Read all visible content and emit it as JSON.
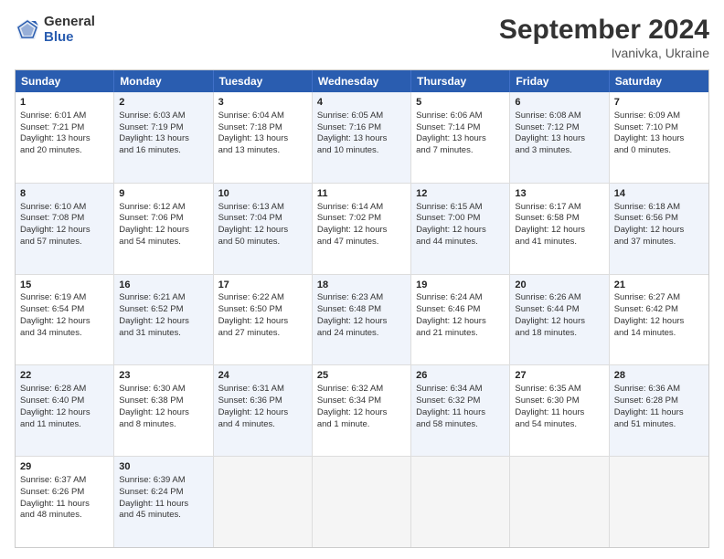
{
  "header": {
    "logo_general": "General",
    "logo_blue": "Blue",
    "month_title": "September 2024",
    "subtitle": "Ivanivka, Ukraine"
  },
  "calendar": {
    "days_of_week": [
      "Sunday",
      "Monday",
      "Tuesday",
      "Wednesday",
      "Thursday",
      "Friday",
      "Saturday"
    ],
    "rows": [
      [
        {
          "day": "1",
          "info": "Sunrise: 6:01 AM\nSunset: 7:21 PM\nDaylight: 13 hours\nand 20 minutes.",
          "empty": false,
          "alt": false
        },
        {
          "day": "2",
          "info": "Sunrise: 6:03 AM\nSunset: 7:19 PM\nDaylight: 13 hours\nand 16 minutes.",
          "empty": false,
          "alt": true
        },
        {
          "day": "3",
          "info": "Sunrise: 6:04 AM\nSunset: 7:18 PM\nDaylight: 13 hours\nand 13 minutes.",
          "empty": false,
          "alt": false
        },
        {
          "day": "4",
          "info": "Sunrise: 6:05 AM\nSunset: 7:16 PM\nDaylight: 13 hours\nand 10 minutes.",
          "empty": false,
          "alt": true
        },
        {
          "day": "5",
          "info": "Sunrise: 6:06 AM\nSunset: 7:14 PM\nDaylight: 13 hours\nand 7 minutes.",
          "empty": false,
          "alt": false
        },
        {
          "day": "6",
          "info": "Sunrise: 6:08 AM\nSunset: 7:12 PM\nDaylight: 13 hours\nand 3 minutes.",
          "empty": false,
          "alt": true
        },
        {
          "day": "7",
          "info": "Sunrise: 6:09 AM\nSunset: 7:10 PM\nDaylight: 13 hours\nand 0 minutes.",
          "empty": false,
          "alt": false
        }
      ],
      [
        {
          "day": "8",
          "info": "Sunrise: 6:10 AM\nSunset: 7:08 PM\nDaylight: 12 hours\nand 57 minutes.",
          "empty": false,
          "alt": true
        },
        {
          "day": "9",
          "info": "Sunrise: 6:12 AM\nSunset: 7:06 PM\nDaylight: 12 hours\nand 54 minutes.",
          "empty": false,
          "alt": false
        },
        {
          "day": "10",
          "info": "Sunrise: 6:13 AM\nSunset: 7:04 PM\nDaylight: 12 hours\nand 50 minutes.",
          "empty": false,
          "alt": true
        },
        {
          "day": "11",
          "info": "Sunrise: 6:14 AM\nSunset: 7:02 PM\nDaylight: 12 hours\nand 47 minutes.",
          "empty": false,
          "alt": false
        },
        {
          "day": "12",
          "info": "Sunrise: 6:15 AM\nSunset: 7:00 PM\nDaylight: 12 hours\nand 44 minutes.",
          "empty": false,
          "alt": true
        },
        {
          "day": "13",
          "info": "Sunrise: 6:17 AM\nSunset: 6:58 PM\nDaylight: 12 hours\nand 41 minutes.",
          "empty": false,
          "alt": false
        },
        {
          "day": "14",
          "info": "Sunrise: 6:18 AM\nSunset: 6:56 PM\nDaylight: 12 hours\nand 37 minutes.",
          "empty": false,
          "alt": true
        }
      ],
      [
        {
          "day": "15",
          "info": "Sunrise: 6:19 AM\nSunset: 6:54 PM\nDaylight: 12 hours\nand 34 minutes.",
          "empty": false,
          "alt": false
        },
        {
          "day": "16",
          "info": "Sunrise: 6:21 AM\nSunset: 6:52 PM\nDaylight: 12 hours\nand 31 minutes.",
          "empty": false,
          "alt": true
        },
        {
          "day": "17",
          "info": "Sunrise: 6:22 AM\nSunset: 6:50 PM\nDaylight: 12 hours\nand 27 minutes.",
          "empty": false,
          "alt": false
        },
        {
          "day": "18",
          "info": "Sunrise: 6:23 AM\nSunset: 6:48 PM\nDaylight: 12 hours\nand 24 minutes.",
          "empty": false,
          "alt": true
        },
        {
          "day": "19",
          "info": "Sunrise: 6:24 AM\nSunset: 6:46 PM\nDaylight: 12 hours\nand 21 minutes.",
          "empty": false,
          "alt": false
        },
        {
          "day": "20",
          "info": "Sunrise: 6:26 AM\nSunset: 6:44 PM\nDaylight: 12 hours\nand 18 minutes.",
          "empty": false,
          "alt": true
        },
        {
          "day": "21",
          "info": "Sunrise: 6:27 AM\nSunset: 6:42 PM\nDaylight: 12 hours\nand 14 minutes.",
          "empty": false,
          "alt": false
        }
      ],
      [
        {
          "day": "22",
          "info": "Sunrise: 6:28 AM\nSunset: 6:40 PM\nDaylight: 12 hours\nand 11 minutes.",
          "empty": false,
          "alt": true
        },
        {
          "day": "23",
          "info": "Sunrise: 6:30 AM\nSunset: 6:38 PM\nDaylight: 12 hours\nand 8 minutes.",
          "empty": false,
          "alt": false
        },
        {
          "day": "24",
          "info": "Sunrise: 6:31 AM\nSunset: 6:36 PM\nDaylight: 12 hours\nand 4 minutes.",
          "empty": false,
          "alt": true
        },
        {
          "day": "25",
          "info": "Sunrise: 6:32 AM\nSunset: 6:34 PM\nDaylight: 12 hours\nand 1 minute.",
          "empty": false,
          "alt": false
        },
        {
          "day": "26",
          "info": "Sunrise: 6:34 AM\nSunset: 6:32 PM\nDaylight: 11 hours\nand 58 minutes.",
          "empty": false,
          "alt": true
        },
        {
          "day": "27",
          "info": "Sunrise: 6:35 AM\nSunset: 6:30 PM\nDaylight: 11 hours\nand 54 minutes.",
          "empty": false,
          "alt": false
        },
        {
          "day": "28",
          "info": "Sunrise: 6:36 AM\nSunset: 6:28 PM\nDaylight: 11 hours\nand 51 minutes.",
          "empty": false,
          "alt": true
        }
      ],
      [
        {
          "day": "29",
          "info": "Sunrise: 6:37 AM\nSunset: 6:26 PM\nDaylight: 11 hours\nand 48 minutes.",
          "empty": false,
          "alt": false
        },
        {
          "day": "30",
          "info": "Sunrise: 6:39 AM\nSunset: 6:24 PM\nDaylight: 11 hours\nand 45 minutes.",
          "empty": false,
          "alt": true
        },
        {
          "day": "",
          "info": "",
          "empty": true,
          "alt": false
        },
        {
          "day": "",
          "info": "",
          "empty": true,
          "alt": false
        },
        {
          "day": "",
          "info": "",
          "empty": true,
          "alt": false
        },
        {
          "day": "",
          "info": "",
          "empty": true,
          "alt": false
        },
        {
          "day": "",
          "info": "",
          "empty": true,
          "alt": false
        }
      ]
    ]
  }
}
